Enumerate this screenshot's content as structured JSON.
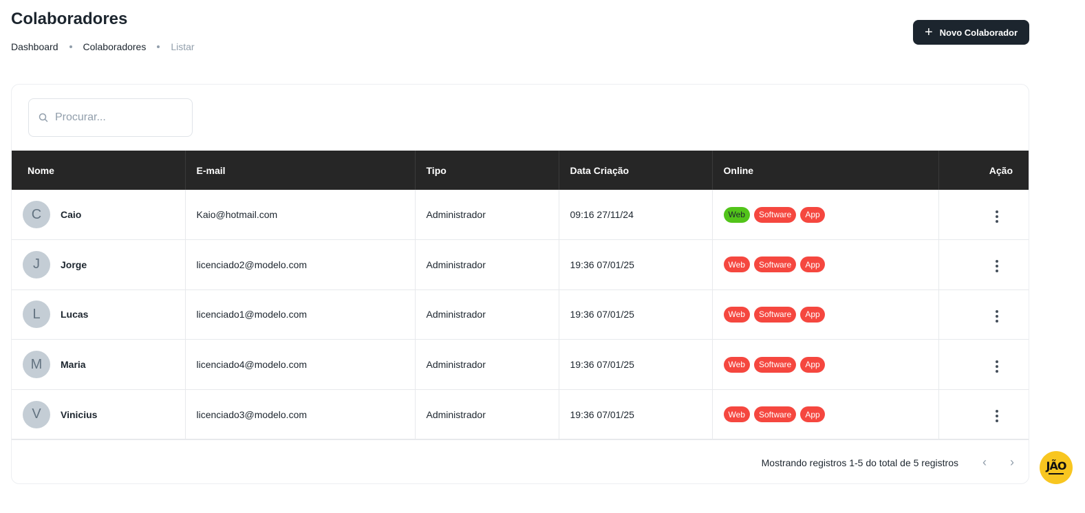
{
  "header": {
    "title": "Colaboradores",
    "breadcrumb": [
      "Dashboard",
      "Colaboradores",
      "Listar"
    ],
    "new_button_label": "Novo Colaborador"
  },
  "search": {
    "placeholder": "Procurar..."
  },
  "table": {
    "columns": [
      "Nome",
      "E-mail",
      "Tipo",
      "Data Criação",
      "Online",
      "Ação"
    ],
    "tag_labels": [
      "Web",
      "Software",
      "App"
    ],
    "rows": [
      {
        "initial": "C",
        "name": "Caio",
        "email": "Kaio@hotmail.com",
        "type": "Administrador",
        "created": "09:16 27/11/24",
        "online": {
          "web": true,
          "software": false,
          "app": false
        }
      },
      {
        "initial": "J",
        "name": "Jorge",
        "email": "licenciado2@modelo.com",
        "type": "Administrador",
        "created": "19:36 07/01/25",
        "online": {
          "web": false,
          "software": false,
          "app": false
        }
      },
      {
        "initial": "L",
        "name": "Lucas",
        "email": "licenciado1@modelo.com",
        "type": "Administrador",
        "created": "19:36 07/01/25",
        "online": {
          "web": false,
          "software": false,
          "app": false
        }
      },
      {
        "initial": "M",
        "name": "Maria",
        "email": "licenciado4@modelo.com",
        "type": "Administrador",
        "created": "19:36 07/01/25",
        "online": {
          "web": false,
          "software": false,
          "app": false
        }
      },
      {
        "initial": "V",
        "name": "Vinicius",
        "email": "licenciado3@modelo.com",
        "type": "Administrador",
        "created": "19:36 07/01/25",
        "online": {
          "web": false,
          "software": false,
          "app": false
        }
      }
    ]
  },
  "footer": {
    "summary": "Mostrando registros 1-5 do total de 5 registros"
  },
  "fab": {
    "logo_text": "JÃO"
  },
  "colors": {
    "online": "#52c41a",
    "offline": "#f5473f",
    "header_bg": "#262626",
    "fab_bg": "#f8c620"
  }
}
